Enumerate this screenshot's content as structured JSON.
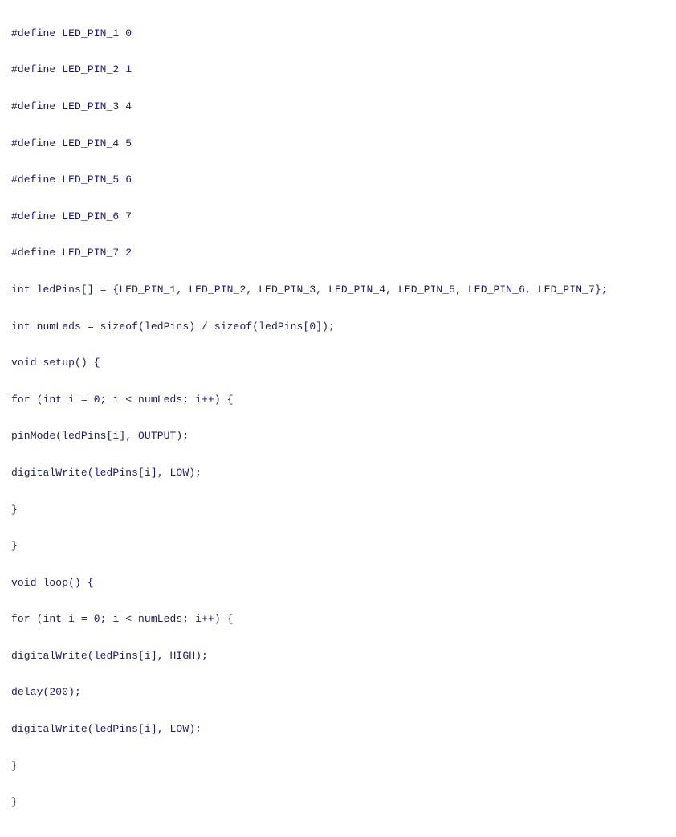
{
  "code": {
    "lines": [
      "#define LED_PIN_1 0",
      "#define LED_PIN_2 1",
      "#define LED_PIN_3 4",
      "#define LED_PIN_4 5",
      "#define LED_PIN_5 6",
      "#define LED_PIN_6 7",
      "#define LED_PIN_7 2",
      "int ledPins[] = {LED_PIN_1, LED_PIN_2, LED_PIN_3, LED_PIN_4, LED_PIN_5, LED_PIN_6, LED_PIN_7};",
      "int numLeds = sizeof(ledPins) / sizeof(ledPins[0]);",
      "void setup() {",
      "for (int i = 0; i < numLeds; i++) {",
      "pinMode(ledPins[i], OUTPUT);",
      "digitalWrite(ledPins[i], LOW);",
      "}",
      "}",
      "void loop() {",
      "for (int i = 0; i < numLeds; i++) {",
      "digitalWrite(ledPins[i], HIGH);",
      "delay(200);",
      "digitalWrite(ledPins[i], LOW);",
      "}",
      "}"
    ]
  }
}
